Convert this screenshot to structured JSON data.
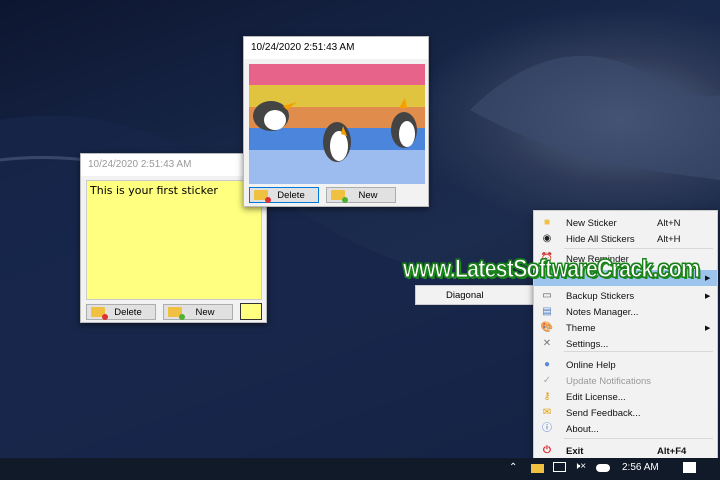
{
  "sticker_picture": {
    "timestamp": "10/24/2020 2:51:43 AM",
    "delete_label": "Delete",
    "new_label": "New",
    "stripe_colors": [
      "#e8638a",
      "#e0c440",
      "#e08c4c",
      "#4c86dc",
      "#9cbcf0"
    ]
  },
  "sticker_text": {
    "timestamp": "10/24/2020 2:51:43 AM",
    "content": "This is your first sticker",
    "delete_label": "Delete",
    "new_label": "New",
    "color": "#ffff80"
  },
  "submenu": {
    "items": [
      {
        "label": "Diagonal"
      }
    ]
  },
  "context_menu": {
    "items": [
      {
        "label": "New Sticker",
        "shortcut": "Alt+N",
        "icon": "new-sticker-icon"
      },
      {
        "label": "Hide All Stickers",
        "shortcut": "Alt+H",
        "icon": "hide-eye-icon"
      },
      {
        "label": "New Reminder",
        "icon": "reminder-icon"
      },
      {
        "label": "",
        "icon": "",
        "submenu": true,
        "highlighted": true
      },
      {
        "label": "Backup Stickers",
        "icon": "backup-disk-icon",
        "submenu": true
      },
      {
        "label": "Notes Manager...",
        "icon": "notes-manager-icon"
      },
      {
        "label": "Theme",
        "icon": "palette-icon",
        "submenu": true
      },
      {
        "label": "Settings...",
        "icon": "tools-icon"
      },
      {
        "label": "Online Help",
        "icon": "help-icon"
      },
      {
        "label": "Update Notifications",
        "icon": "check-icon",
        "disabled": true
      },
      {
        "label": "Edit License...",
        "icon": "key-icon"
      },
      {
        "label": "Send Feedback...",
        "icon": "envelope-icon"
      },
      {
        "label": "About...",
        "icon": "info-icon"
      },
      {
        "label": "Exit",
        "shortcut": "Alt+F4",
        "icon": "power-icon",
        "bold": true
      }
    ]
  },
  "watermark": "www.LatestSoftwareCrack.com",
  "taskbar": {
    "time": "2:56 AM"
  }
}
